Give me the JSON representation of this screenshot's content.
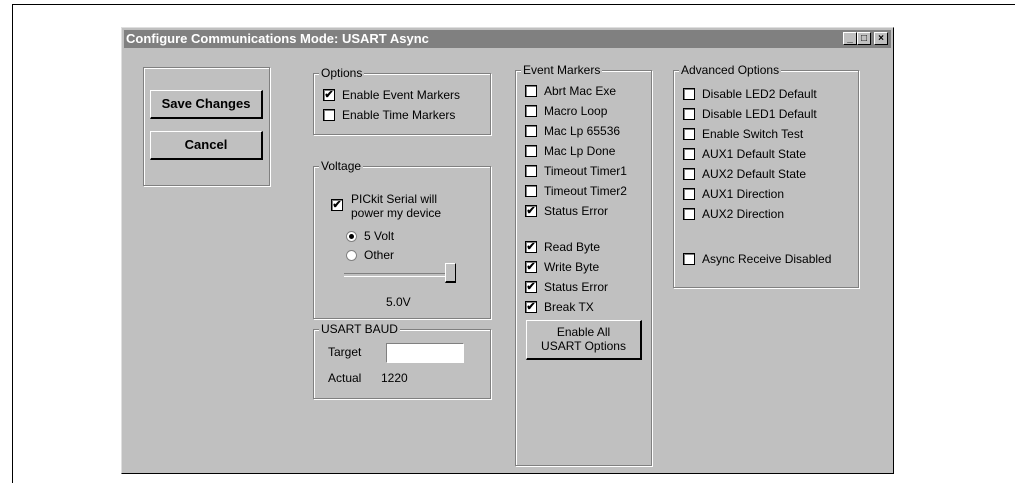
{
  "window": {
    "title": "Configure Communications Mode: USART Async"
  },
  "buttons": {
    "save": "Save Changes",
    "cancel": "Cancel",
    "enable_all": [
      "Enable All",
      "USART Options"
    ]
  },
  "options": {
    "label": "Options",
    "items": [
      {
        "label": "Enable Event Markers",
        "checked": true
      },
      {
        "label": "Enable Time Markers",
        "checked": false
      }
    ]
  },
  "voltage": {
    "label": "Voltage",
    "power_label_1": "PICkit Serial will",
    "power_label_2": "power my device",
    "power_checked": true,
    "radios": [
      {
        "label": "5 Volt",
        "selected": true
      },
      {
        "label": "Other",
        "selected": false
      }
    ],
    "slider_level": 1.0,
    "value": "5.0V"
  },
  "usart_baud": {
    "label": "USART  BAUD",
    "target_label": "Target",
    "target_value": "",
    "actual_label": "Actual",
    "actual_value": "1220"
  },
  "event_markers": {
    "label": "Event Markers",
    "items": [
      {
        "label": "Abrt Mac Exe",
        "checked": false
      },
      {
        "label": "Macro Loop",
        "checked": false
      },
      {
        "label": "Mac Lp 65536",
        "checked": false
      },
      {
        "label": "Mac Lp Done",
        "checked": false
      },
      {
        "label": "Timeout Timer1",
        "checked": false
      },
      {
        "label": "Timeout Timer2",
        "checked": false
      },
      {
        "label": "Status Error",
        "checked": true
      }
    ],
    "items2": [
      {
        "label": "Read Byte",
        "checked": true
      },
      {
        "label": "Write Byte",
        "checked": true
      },
      {
        "label": "Status Error",
        "checked": true
      },
      {
        "label": "Break TX",
        "checked": true
      }
    ]
  },
  "advanced": {
    "label": "Advanced Options",
    "items": [
      {
        "label": "Disable LED2 Default",
        "checked": false
      },
      {
        "label": "Disable LED1 Default",
        "checked": false
      },
      {
        "label": "Enable Switch Test",
        "checked": false
      },
      {
        "label": "AUX1 Default State",
        "checked": false
      },
      {
        "label": "AUX2 Default State",
        "checked": false
      },
      {
        "label": "AUX1 Direction",
        "checked": false
      },
      {
        "label": "AUX2 Direction",
        "checked": false
      }
    ],
    "async": {
      "label": "Async Receive Disabled",
      "checked": false
    }
  },
  "titlebar_buttons": {
    "minimize": "_",
    "maximize": "□",
    "close": "×"
  }
}
